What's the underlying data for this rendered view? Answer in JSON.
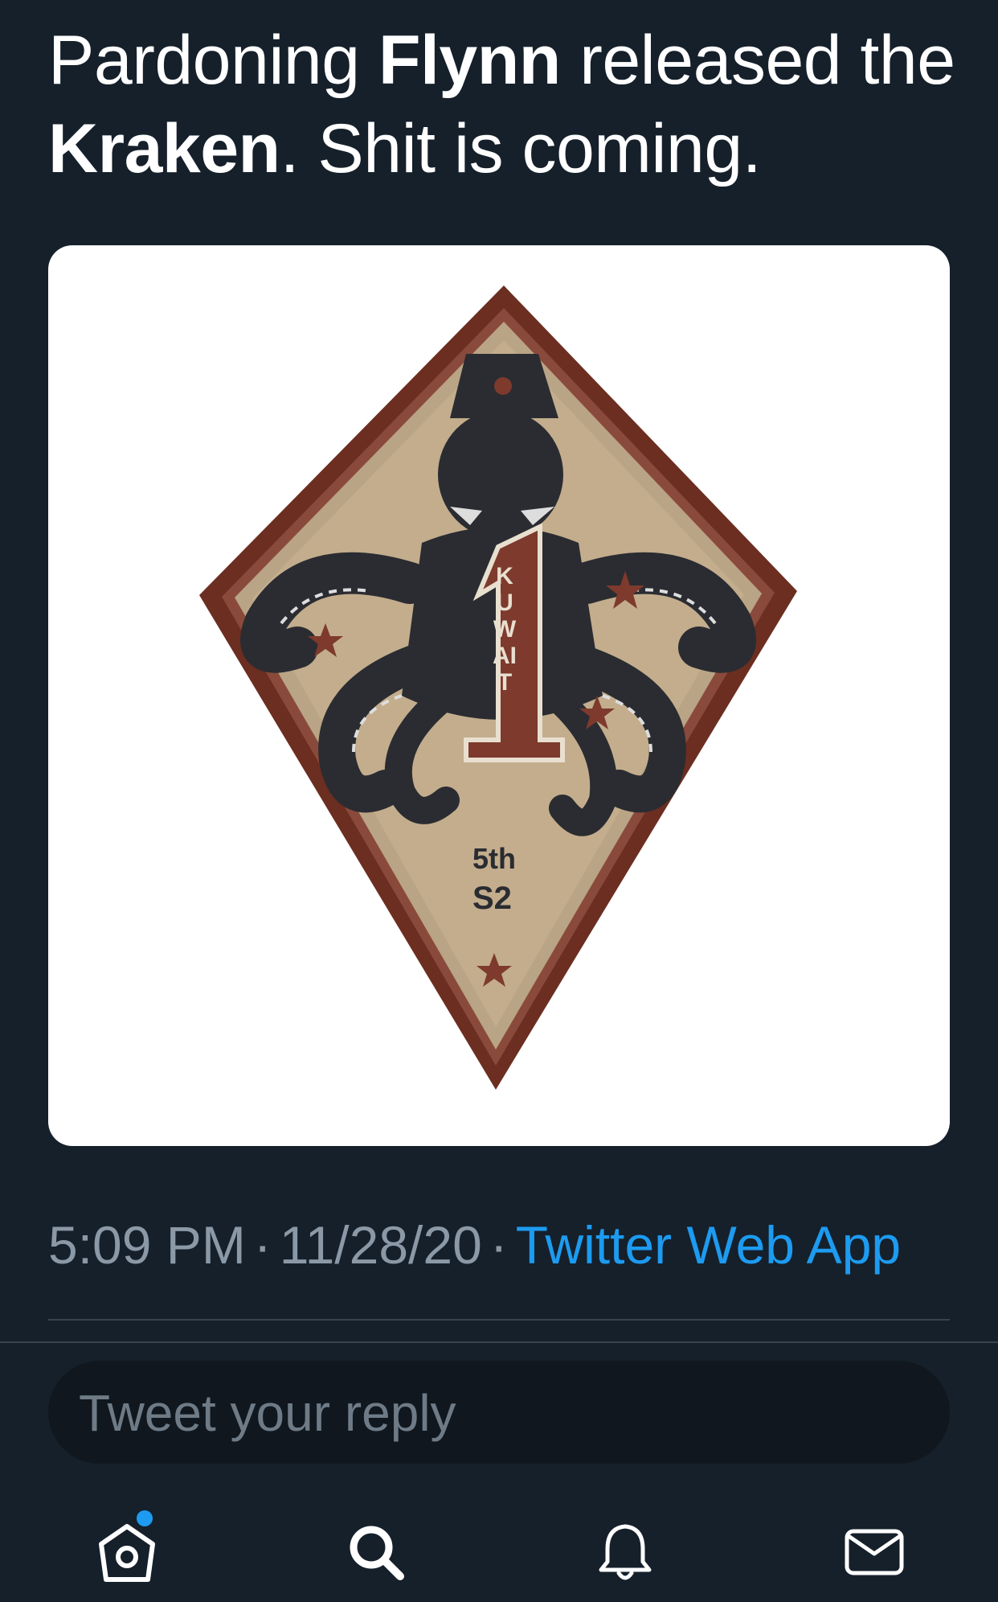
{
  "tweet": {
    "text_parts": {
      "p1": "Pardoning ",
      "p2": "Flynn",
      "p3": " released the ",
      "p4": "Kraken",
      "p5": ". Shit is coming."
    },
    "timestamp_time": "5:09 PM",
    "separator": "·",
    "timestamp_date": "11/28/20",
    "source": "Twitter Web App"
  },
  "media": {
    "patch_text_vertical": "KUWAIT",
    "patch_number": "1",
    "patch_unit": "5th",
    "patch_code": "S2"
  },
  "reply": {
    "placeholder": "Tweet your reply"
  },
  "tabbar": {
    "items": [
      {
        "name": "home",
        "icon": "home-icon",
        "has_notification_dot": true
      },
      {
        "name": "search",
        "icon": "search-icon"
      },
      {
        "name": "notifications",
        "icon": "bell-icon"
      },
      {
        "name": "messages",
        "icon": "mail-icon"
      }
    ]
  },
  "colors": {
    "background": "#15202b",
    "accent": "#1d9bf0",
    "muted": "#8b98a5",
    "patch_border": "#6b2e21",
    "patch_fill": "#b7a283",
    "kraken": "#2a2c31"
  }
}
